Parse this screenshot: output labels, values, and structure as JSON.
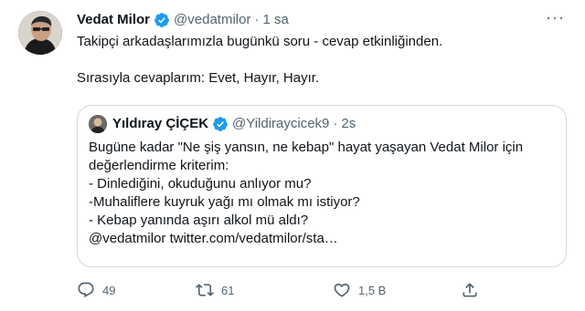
{
  "tweet": {
    "author": {
      "display_name": "Vedat Milor",
      "handle": "@vedatmilor",
      "verified_icon": "verified-badge-icon",
      "avatar_icon": "user-avatar"
    },
    "separator": "·",
    "time": "1 sa",
    "more_icon": "more-options-icon",
    "more_label": "···",
    "text_lines": [
      "Takipçi arkadaşlarımızla bugünkü soru - cevap etkinliğinden.",
      "Sırasıyla cevaplarım: Evet, Hayır, Hayır."
    ],
    "quote": {
      "author": {
        "display_name": "Yıldıray ÇİÇEK",
        "handle": "@Yildiraycicek9",
        "verified_icon": "verified-badge-icon"
      },
      "separator": "·",
      "time": "2s",
      "text_lines": [
        "Bugüne kadar \"Ne şiş yansın, ne kebap\" hayat yaşayan Vedat Milor için",
        "değerlendirme kriterim:",
        "- Dinlediğini, okuduğunu anlıyor mu?",
        "-Muhaliflere kuyruk yağı mı olmak mı istiyor?",
        "- Kebap yanında aşırı alkol mü aldı?",
        "@vedatmilor twitter.com/vedatmilor/sta…"
      ]
    },
    "actions": {
      "reply": {
        "icon": "reply-icon",
        "count": "49"
      },
      "retweet": {
        "icon": "retweet-icon",
        "count": "61"
      },
      "like": {
        "icon": "heart-icon",
        "count": "1,5 B"
      },
      "share": {
        "icon": "share-icon"
      }
    }
  },
  "colors": {
    "verified": "#1d9bf0",
    "text_primary": "#0f1419",
    "text_secondary": "#536471",
    "border": "#cfd9de"
  }
}
